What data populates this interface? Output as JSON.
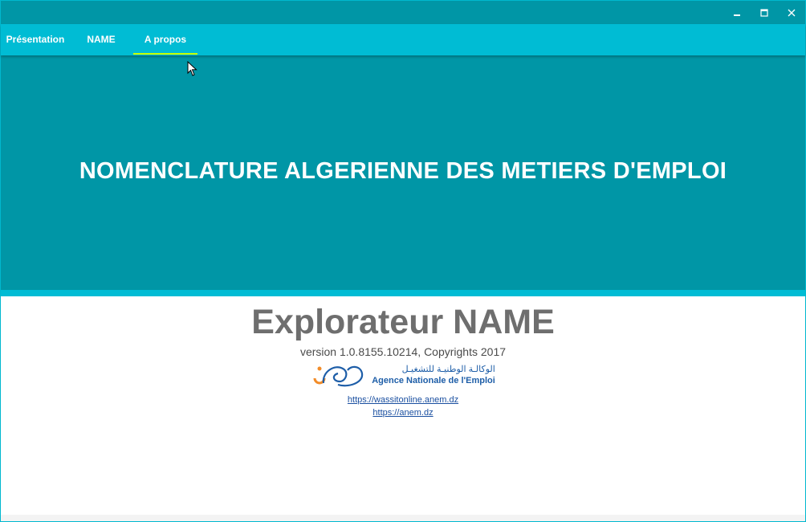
{
  "window_controls": {
    "minimize": "minimize-icon",
    "maximize": "maximize-icon",
    "close": "close-icon"
  },
  "tabs": [
    {
      "label": "Présentation"
    },
    {
      "label": "NAME"
    },
    {
      "label": "A propos",
      "active": true
    }
  ],
  "banner": {
    "title": "NOMENCLATURE ALGERIENNE DES METIERS D'EMPLOI"
  },
  "about": {
    "app_name": "Explorateur NAME",
    "version": "version 1.0.8155.10214, Copyrights 2017",
    "logo": {
      "arabic": "الوكالـة الوطنيـة للتشغيـل",
      "latin": "Agence Nationale de l'Emploi"
    },
    "links": [
      "https://wassitonline.anem.dz",
      "https://anem.dz"
    ]
  },
  "colors": {
    "header_dark": "#0096a6",
    "header_light": "#00bcd4",
    "tab_indicator": "#c6ff00",
    "app_name": "#6e6e6e",
    "link": "#1a4fa0"
  }
}
